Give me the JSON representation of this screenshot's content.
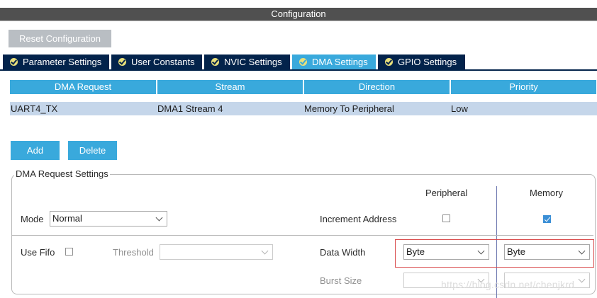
{
  "header": {
    "title": "Configuration"
  },
  "toolbar": {
    "reset_label": "Reset Configuration"
  },
  "tabs": [
    {
      "label": "Parameter Settings",
      "active": false
    },
    {
      "label": "User Constants",
      "active": false
    },
    {
      "label": "NVIC Settings",
      "active": false
    },
    {
      "label": "DMA Settings",
      "active": true
    },
    {
      "label": "GPIO Settings",
      "active": false
    }
  ],
  "table": {
    "columns": [
      "DMA Request",
      "Stream",
      "Direction",
      "Priority"
    ],
    "rows": [
      [
        "UART4_TX",
        "DMA1 Stream 4",
        "Memory To Peripheral",
        "Low"
      ]
    ]
  },
  "actions": {
    "add_label": "Add",
    "delete_label": "Delete"
  },
  "settings": {
    "legend": "DMA Request Settings",
    "peripheral_header": "Peripheral",
    "memory_header": "Memory",
    "mode_label": "Mode",
    "mode_value": "Normal",
    "increment_label": "Increment Address",
    "increment_peripheral_checked": false,
    "increment_memory_checked": true,
    "fifo_label": "Use Fifo",
    "fifo_checked": false,
    "threshold_label": "Threshold",
    "threshold_value": "",
    "data_width_label": "Data Width",
    "data_width_peripheral": "Byte",
    "data_width_memory": "Byte",
    "burst_label": "Burst Size",
    "burst_peripheral": "",
    "burst_memory": ""
  },
  "watermark": "https://blog.csdn.net/chenjkrd",
  "colors": {
    "tab_dark": "#03234b",
    "tab_active": "#39a9dc",
    "header_blue": "#39a9dc",
    "row_selected": "#c5d6ea",
    "highlight_box": "#d9494a"
  }
}
